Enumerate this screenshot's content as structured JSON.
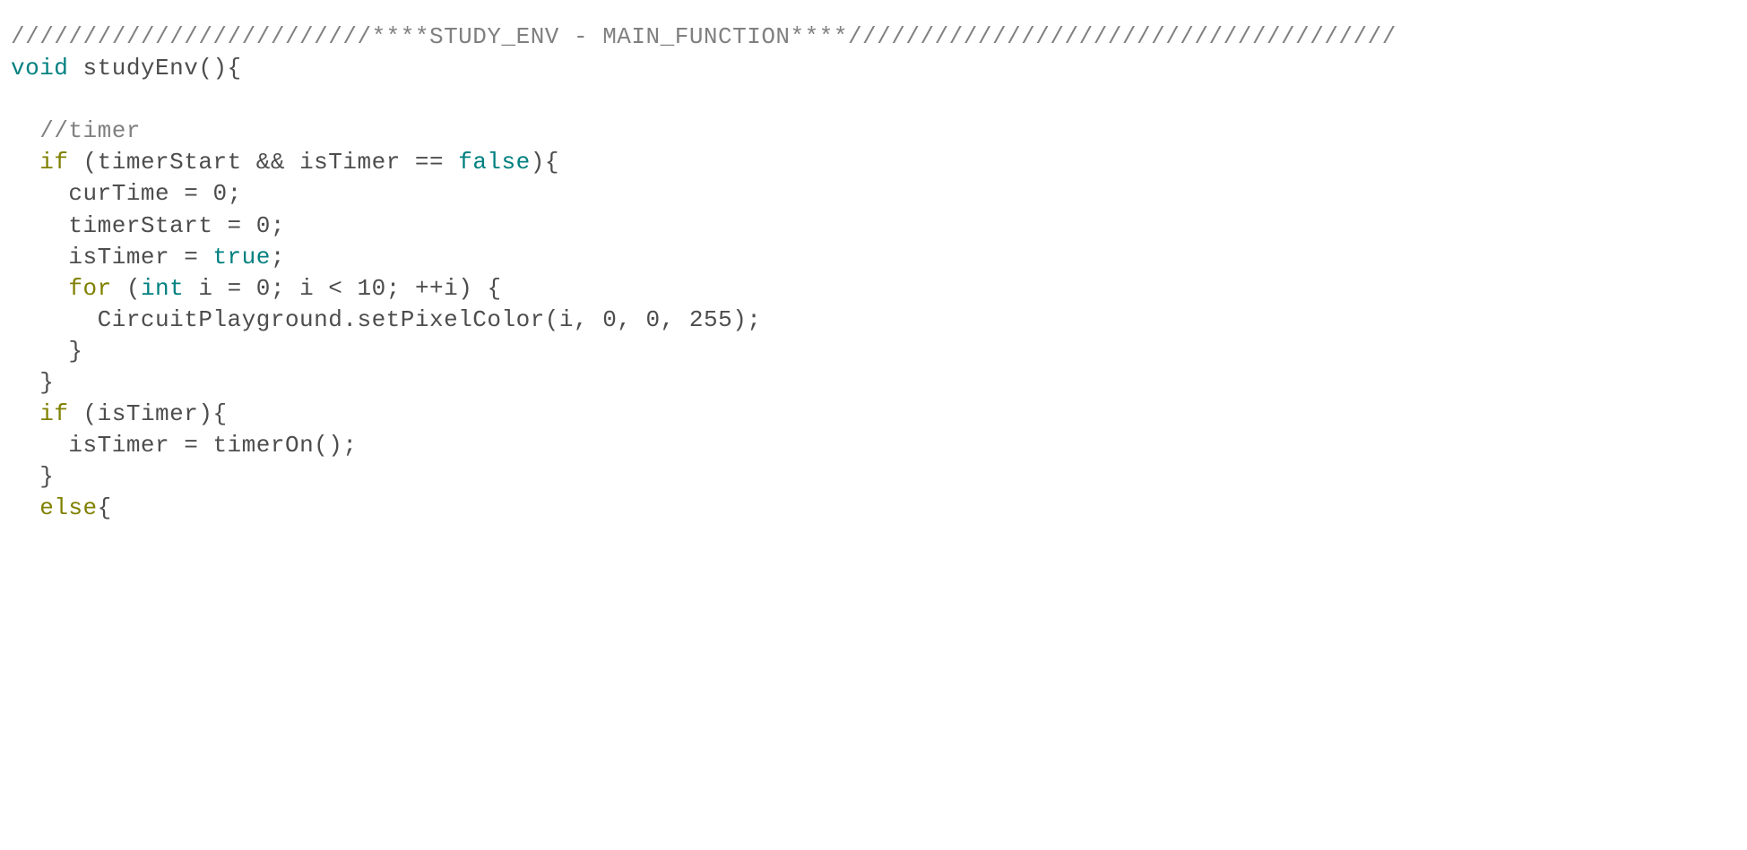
{
  "code": {
    "lines": [
      {
        "indent": 0,
        "tokens": [
          {
            "cls": "c-comment",
            "text": "/////////////////////////****STUDY_ENV - MAIN_FUNCTION****//////////////////////////////////////"
          }
        ]
      },
      {
        "indent": 0,
        "tokens": [
          {
            "cls": "c-type",
            "text": "void"
          },
          {
            "cls": "c-ident",
            "text": " studyEnv(){"
          }
        ]
      },
      {
        "indent": 0,
        "tokens": []
      },
      {
        "indent": 1,
        "tokens": [
          {
            "cls": "c-comment",
            "text": "//timer"
          }
        ]
      },
      {
        "indent": 1,
        "tokens": [
          {
            "cls": "c-keyword",
            "text": "if"
          },
          {
            "cls": "c-ident",
            "text": " (timerStart && isTimer == "
          },
          {
            "cls": "c-literal",
            "text": "false"
          },
          {
            "cls": "c-ident",
            "text": "){"
          }
        ]
      },
      {
        "indent": 2,
        "tokens": [
          {
            "cls": "c-ident",
            "text": "curTime = "
          },
          {
            "cls": "c-num",
            "text": "0"
          },
          {
            "cls": "c-ident",
            "text": ";"
          }
        ]
      },
      {
        "indent": 2,
        "tokens": [
          {
            "cls": "c-ident",
            "text": "timerStart = "
          },
          {
            "cls": "c-num",
            "text": "0"
          },
          {
            "cls": "c-ident",
            "text": ";"
          }
        ]
      },
      {
        "indent": 2,
        "tokens": [
          {
            "cls": "c-ident",
            "text": "isTimer = "
          },
          {
            "cls": "c-literal",
            "text": "true"
          },
          {
            "cls": "c-ident",
            "text": ";"
          }
        ]
      },
      {
        "indent": 2,
        "tokens": [
          {
            "cls": "c-keyword",
            "text": "for"
          },
          {
            "cls": "c-ident",
            "text": " ("
          },
          {
            "cls": "c-type",
            "text": "int"
          },
          {
            "cls": "c-ident",
            "text": " i = "
          },
          {
            "cls": "c-num",
            "text": "0"
          },
          {
            "cls": "c-ident",
            "text": "; i < "
          },
          {
            "cls": "c-num",
            "text": "10"
          },
          {
            "cls": "c-ident",
            "text": "; ++i) {"
          }
        ]
      },
      {
        "indent": 3,
        "tokens": [
          {
            "cls": "c-ident",
            "text": "CircuitPlayground.setPixelColor(i, "
          },
          {
            "cls": "c-num",
            "text": "0"
          },
          {
            "cls": "c-ident",
            "text": ", "
          },
          {
            "cls": "c-num",
            "text": "0"
          },
          {
            "cls": "c-ident",
            "text": ", "
          },
          {
            "cls": "c-num",
            "text": "255"
          },
          {
            "cls": "c-ident",
            "text": ");"
          }
        ]
      },
      {
        "indent": 2,
        "tokens": [
          {
            "cls": "c-ident",
            "text": "}"
          }
        ]
      },
      {
        "indent": 1,
        "tokens": [
          {
            "cls": "c-ident",
            "text": "}"
          }
        ]
      },
      {
        "indent": 1,
        "tokens": [
          {
            "cls": "c-keyword",
            "text": "if"
          },
          {
            "cls": "c-ident",
            "text": " (isTimer){"
          }
        ]
      },
      {
        "indent": 2,
        "tokens": [
          {
            "cls": "c-ident",
            "text": "isTimer = timerOn();"
          }
        ]
      },
      {
        "indent": 1,
        "tokens": [
          {
            "cls": "c-ident",
            "text": "}"
          }
        ]
      },
      {
        "indent": 1,
        "tokens": [
          {
            "cls": "c-keyword",
            "text": "else"
          },
          {
            "cls": "c-ident",
            "text": "{"
          }
        ]
      }
    ],
    "indent_unit": "  "
  }
}
